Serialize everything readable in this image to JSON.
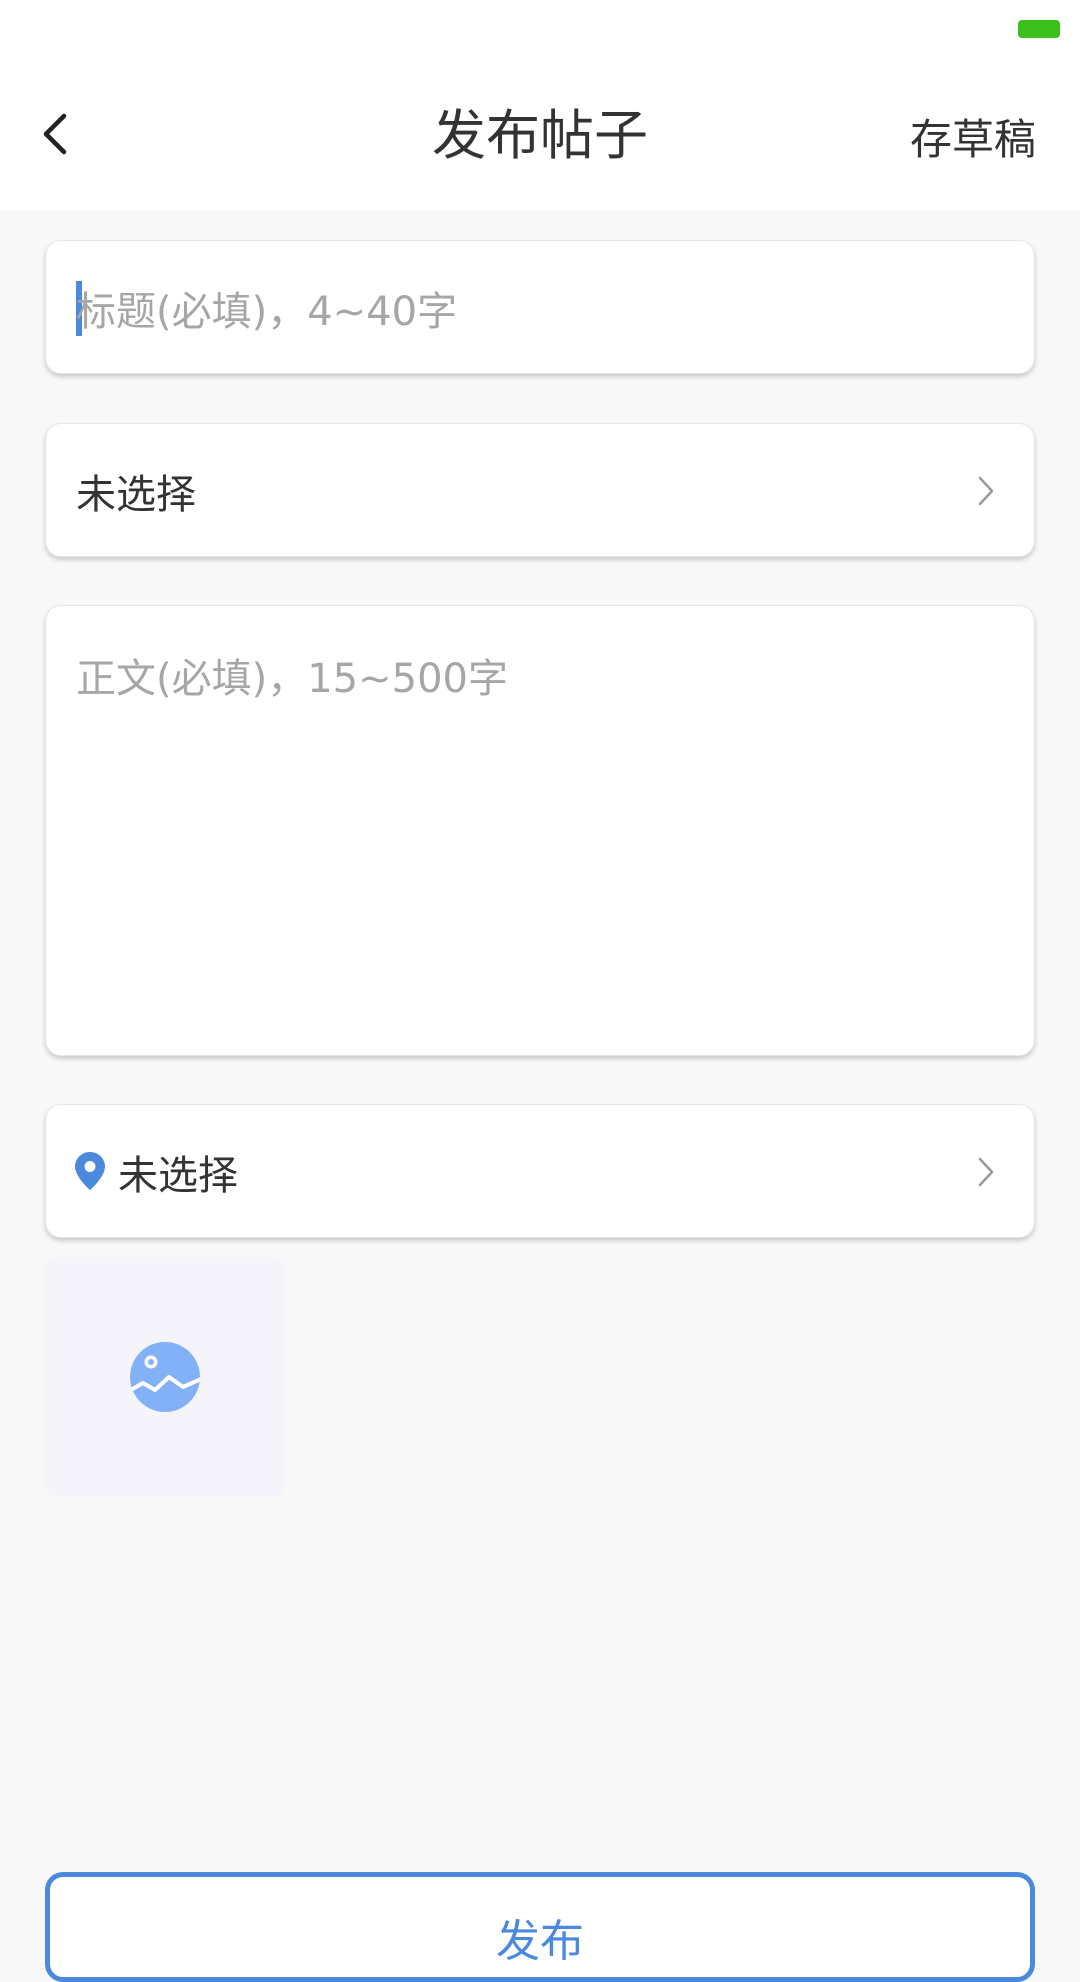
{
  "header": {
    "title": "发布帖子",
    "draft_label": "存草稿"
  },
  "form": {
    "title_placeholder": "标题(必填)，4~40字",
    "category_value": "未选择",
    "content_placeholder": "正文(必填)，15~500字",
    "location_value": "未选择"
  },
  "submit": {
    "label": "发布"
  },
  "colors": {
    "accent": "#4a89dc",
    "battery": "#3bbf1d",
    "placeholder": "#a6a6a6",
    "text": "#333333"
  },
  "icons": {
    "back": "chevron-left-icon",
    "chevron": "chevron-right-icon",
    "location": "location-pin-icon",
    "image": "image-icon",
    "battery": "battery-icon"
  }
}
